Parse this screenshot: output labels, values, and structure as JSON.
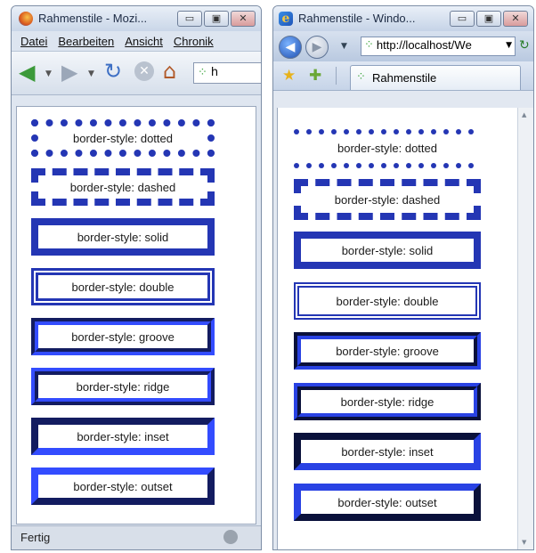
{
  "firefox": {
    "title": "Rahmenstile - Mozi...",
    "menu": [
      "Datei",
      "Bearbeiten",
      "Ansicht",
      "Chronik"
    ],
    "status": "Fertig"
  },
  "ie": {
    "title": "Rahmenstile - Windo...",
    "address": "http://localhost/Wе",
    "tab_label": "Rahmenstile"
  },
  "styles": {
    "dotted": "border-style: dotted",
    "dashed": "border-style: dashed",
    "solid": "border-style: solid",
    "double": "border-style: double",
    "groove": "border-style: groove",
    "ridge": "border-style: ridge",
    "inset": "border-style: inset",
    "outset": "border-style: outset"
  },
  "colors": {
    "border_blue": "#2436b4"
  },
  "icons": [
    "firefox-app-icon",
    "ie-app-icon",
    "back-arrow-icon",
    "forward-arrow-icon",
    "reload-icon",
    "stop-icon",
    "home-icon",
    "site-favicon",
    "favorites-star-icon",
    "add-favorites-icon",
    "status-icon"
  ]
}
